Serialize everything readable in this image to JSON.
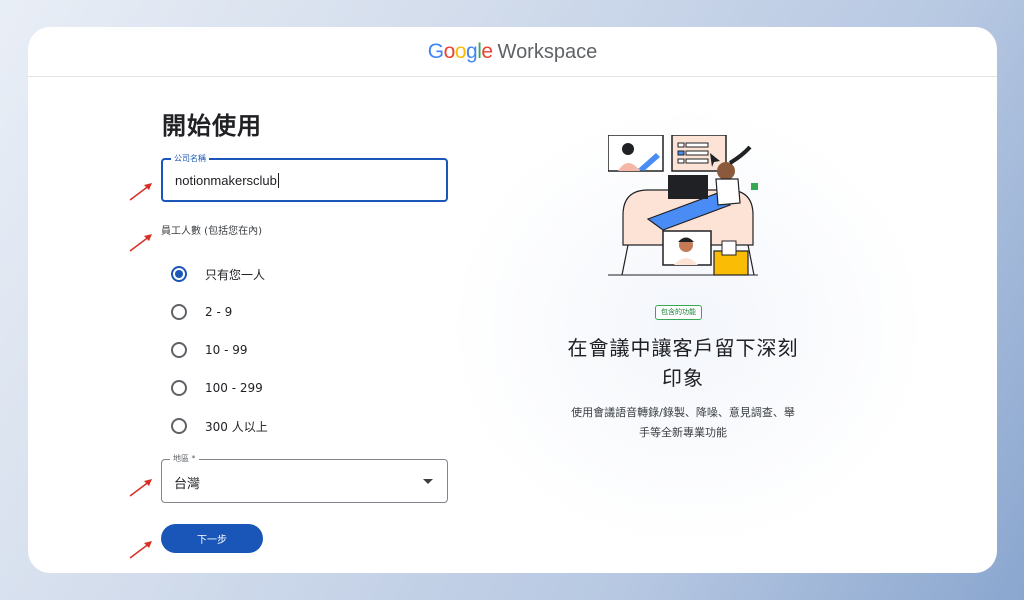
{
  "header": {
    "logo_google": [
      "G",
      "o",
      "o",
      "g",
      "l",
      "e"
    ],
    "logo_colors": [
      "#4285F4",
      "#EA4335",
      "#FBBC05",
      "#4285F4",
      "#34A853",
      "#EA4335"
    ],
    "product": "Workspace"
  },
  "form": {
    "title": "開始使用",
    "company_field": {
      "label": "公司名稱",
      "value": "notionmakersclub"
    },
    "employee_label": "員工人數 (包括您在內)",
    "employee_options": [
      {
        "label": "只有您一人",
        "checked": true
      },
      {
        "label": "2 - 9",
        "checked": false
      },
      {
        "label": "10 - 99",
        "checked": false
      },
      {
        "label": "100 - 299",
        "checked": false
      },
      {
        "label": "300 人以上",
        "checked": false
      }
    ],
    "region_field": {
      "label": "地區 *",
      "value": "台灣"
    },
    "next_button": "下一步"
  },
  "promo": {
    "badge": "包含的功能",
    "title_line1": "在會議中讓客戶留下深刻",
    "title_line2": "印象",
    "desc_line1": "使用會議語音轉錄/錄製、降噪、意見調查、舉",
    "desc_line2": "手等全新專業功能"
  },
  "colors": {
    "accent": "#1a56b8",
    "annotation_arrow": "#d93025"
  }
}
